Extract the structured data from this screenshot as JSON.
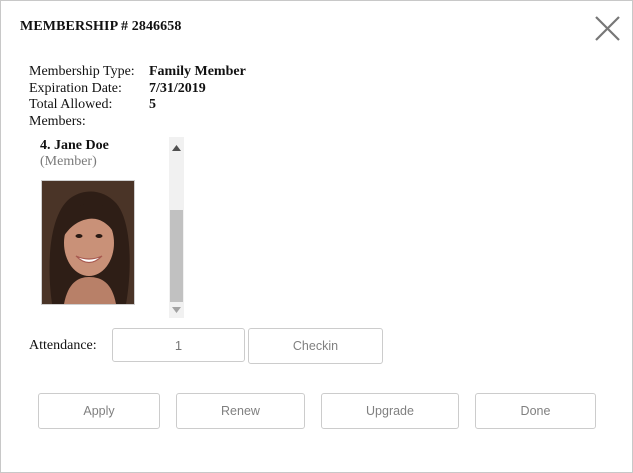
{
  "dialog": {
    "title": "MEMBERSHIP # 2846658"
  },
  "info": {
    "type_label": "Membership Type:",
    "type_value": "Family Member",
    "expiration_label": "Expiration Date:",
    "expiration_value": "7/31/2019",
    "allowed_label": "Total Allowed:",
    "allowed_value": "5",
    "members_label": "Members:"
  },
  "member": {
    "name": "4. Jane Doe",
    "role": "(Member)"
  },
  "attendance": {
    "label": "Attendance:",
    "value": "1",
    "checkin_label": "Checkin"
  },
  "actions": {
    "apply": "Apply",
    "renew": "Renew",
    "upgrade": "Upgrade",
    "done": "Done"
  },
  "icons": {
    "close": "close-icon",
    "scroll_up": "arrow-up-icon",
    "scroll_down": "arrow-down-icon"
  },
  "colors": {
    "border": "#cccccc",
    "button_text": "#808080",
    "role_text": "#7a7a7a",
    "scroll_thumb": "#c1c1c1"
  }
}
